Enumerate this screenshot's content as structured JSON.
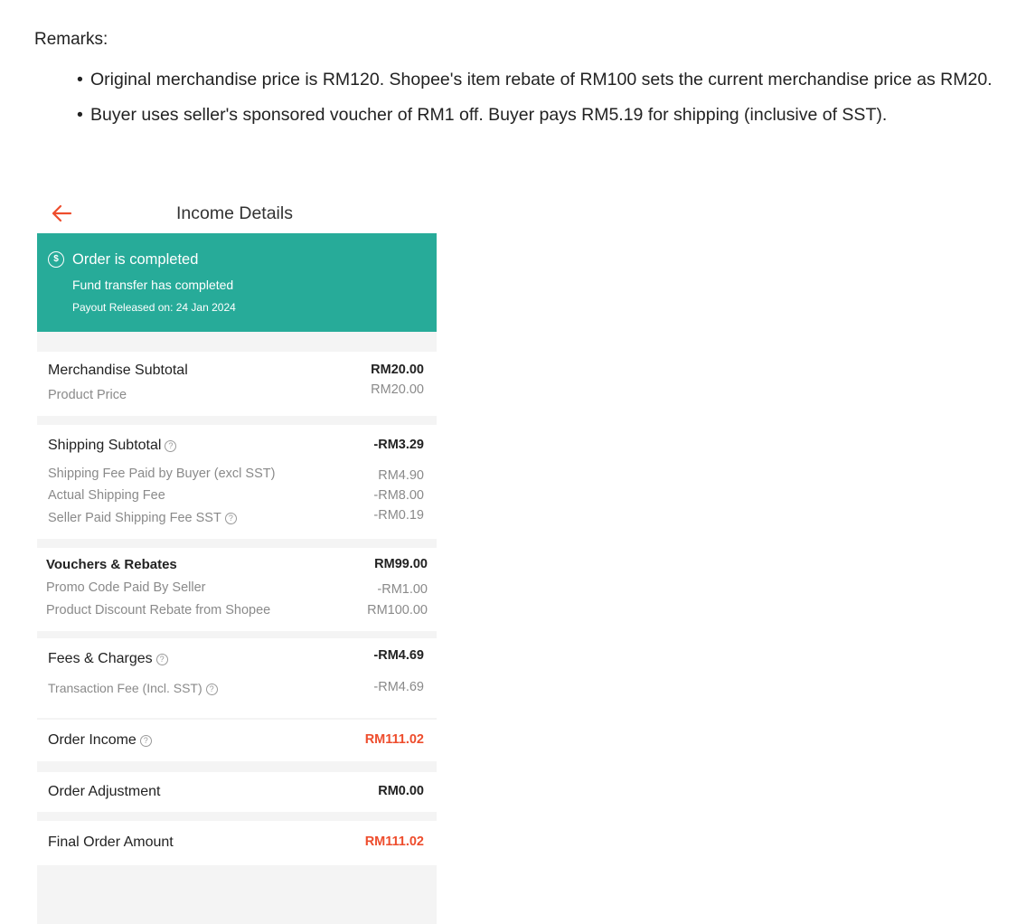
{
  "remarks": {
    "title": "Remarks:",
    "items": [
      "Original merchandise price is RM120. Shopee's item rebate of RM100 sets the current merchandise price as RM20.",
      "Buyer uses seller's sponsored voucher of RM1 off. Buyer pays RM5.19 for shipping (inclusive of SST)."
    ]
  },
  "header": {
    "title": "Income Details",
    "back_icon": "arrow-left-icon"
  },
  "banner": {
    "status": "Order is completed",
    "subtitle": "Fund transfer has completed",
    "payout": "Payout Released on: 24 Jan 2024",
    "icon": "dollar-coin-icon",
    "color": "#27ab99"
  },
  "merchandise": {
    "title": "Merchandise Subtotal",
    "total": "RM20.00",
    "items": [
      {
        "label": "Product Price",
        "value": "RM20.00"
      }
    ]
  },
  "shipping": {
    "title": "Shipping Subtotal",
    "total": "-RM3.29",
    "items": [
      {
        "label": "Shipping Fee Paid by Buyer (excl SST)",
        "value": "RM4.90"
      },
      {
        "label": "Actual Shipping Fee",
        "value": "-RM8.00"
      },
      {
        "label": "Seller Paid Shipping Fee SST",
        "value": "-RM0.19"
      }
    ]
  },
  "vouchers": {
    "title": "Vouchers & Rebates",
    "total": "RM99.00",
    "items": [
      {
        "label": "Promo Code Paid By Seller",
        "value": "-RM1.00"
      },
      {
        "label": "Product Discount Rebate from Shopee",
        "value": "RM100.00"
      }
    ]
  },
  "fees": {
    "title": "Fees & Charges",
    "total": "-RM4.69",
    "items": [
      {
        "label": "Transaction Fee (Incl. SST)",
        "value": "-RM4.69"
      }
    ]
  },
  "order_income": {
    "label": "Order Income",
    "value": "RM111.02"
  },
  "order_adjustment": {
    "label": "Order Adjustment",
    "value": "RM0.00"
  },
  "final_amount": {
    "label": "Final Order Amount",
    "value": "RM111.02"
  },
  "colors": {
    "accent": "#ee4d2d",
    "banner": "#27ab99",
    "muted": "#8a8a8a"
  }
}
